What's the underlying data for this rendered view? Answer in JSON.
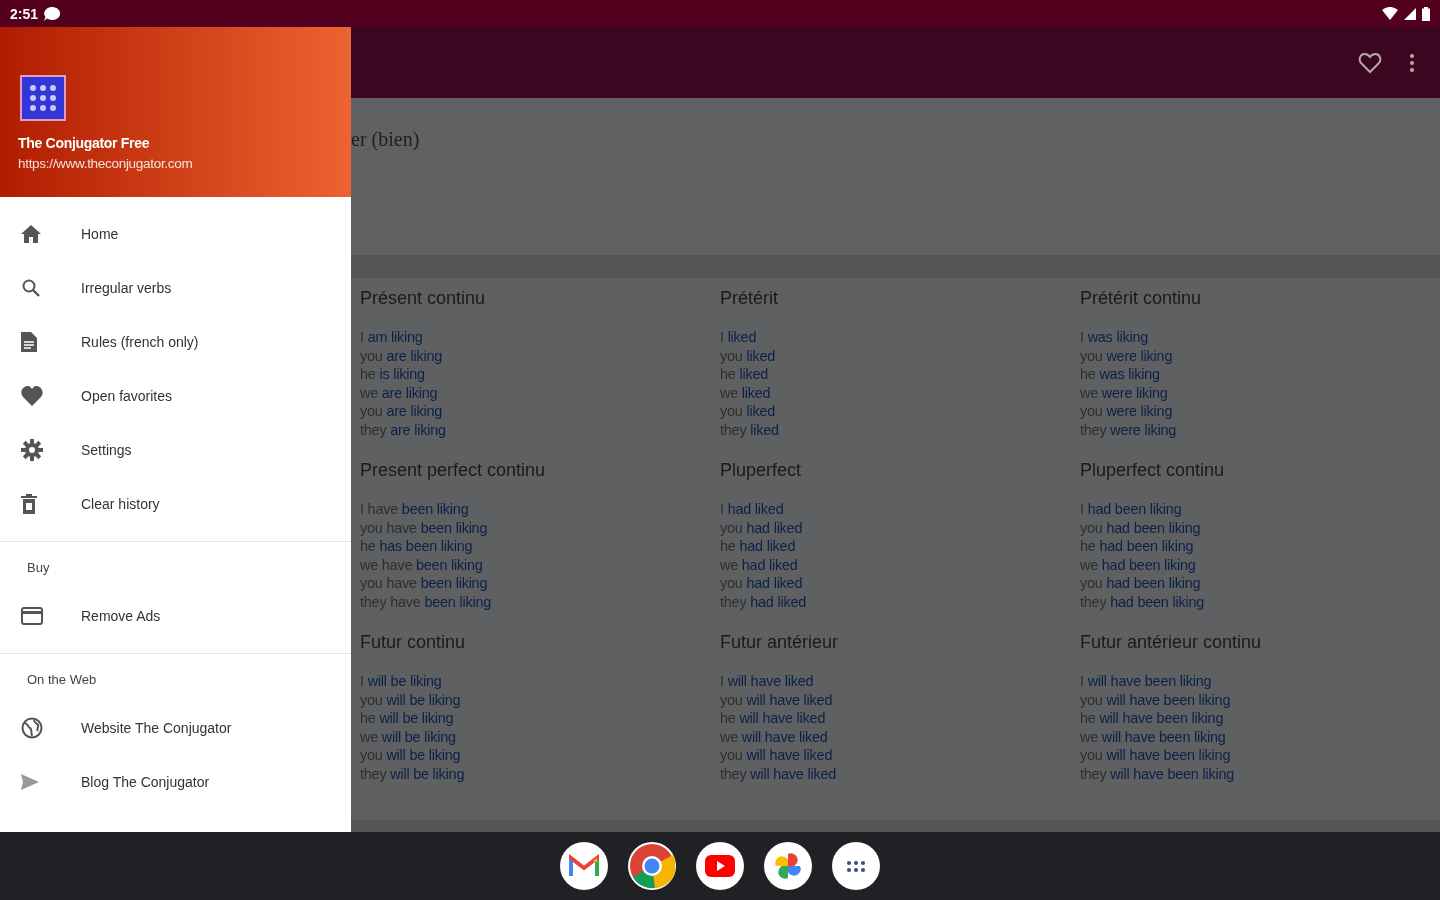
{
  "status_bar": {
    "time": "2:51"
  },
  "drawer": {
    "app_name": "The Conjugator Free",
    "url": "https://www.theconjugator.com",
    "sections": [
      {
        "items": [
          "Home",
          "Irregular verbs",
          "Rules (french only)",
          "Open favorites",
          "Settings",
          "Clear history"
        ]
      },
      {
        "header": "Buy",
        "items": [
          "Remove Ads"
        ]
      },
      {
        "header": "On the Web",
        "items": [
          "Website The Conjugator",
          "Blog The Conjugator"
        ]
      }
    ]
  },
  "verb_title": "er (bien)",
  "tenses": [
    {
      "name": "Présent continu",
      "lines": [
        {
          "pronoun": "I",
          "verb": "am liking"
        },
        {
          "pronoun": "you",
          "verb": "are liking"
        },
        {
          "pronoun": "he",
          "verb": "is liking"
        },
        {
          "pronoun": "we",
          "verb": "are liking"
        },
        {
          "pronoun": "you",
          "verb": "are liking"
        },
        {
          "pronoun": "they",
          "verb": "are liking"
        }
      ]
    },
    {
      "name": "Prétérit",
      "lines": [
        {
          "pronoun": "I",
          "verb": "liked"
        },
        {
          "pronoun": "you",
          "verb": "liked"
        },
        {
          "pronoun": "he",
          "verb": "liked"
        },
        {
          "pronoun": "we",
          "verb": "liked"
        },
        {
          "pronoun": "you",
          "verb": "liked"
        },
        {
          "pronoun": "they",
          "verb": "liked"
        }
      ]
    },
    {
      "name": "Prétérit continu",
      "lines": [
        {
          "pronoun": "I",
          "verb": "was liking"
        },
        {
          "pronoun": "you",
          "verb": "were liking"
        },
        {
          "pronoun": "he",
          "verb": "was liking"
        },
        {
          "pronoun": "we",
          "verb": "were liking"
        },
        {
          "pronoun": "you",
          "verb": "were liking"
        },
        {
          "pronoun": "they",
          "verb": "were liking"
        }
      ]
    },
    {
      "name": "Present perfect continu",
      "lines": [
        {
          "pronoun": "I have",
          "verb": "been liking"
        },
        {
          "pronoun": "you have",
          "verb": "been liking"
        },
        {
          "pronoun": "he",
          "verb": "has been liking"
        },
        {
          "pronoun": "we have",
          "verb": "been liking"
        },
        {
          "pronoun": "you have",
          "verb": "been liking"
        },
        {
          "pronoun": "they have",
          "verb": "been liking"
        }
      ]
    },
    {
      "name": "Pluperfect",
      "lines": [
        {
          "pronoun": "I",
          "verb": "had liked"
        },
        {
          "pronoun": "you",
          "verb": "had liked"
        },
        {
          "pronoun": "he",
          "verb": "had liked"
        },
        {
          "pronoun": "we",
          "verb": "had liked"
        },
        {
          "pronoun": "you",
          "verb": "had liked"
        },
        {
          "pronoun": "they",
          "verb": "had liked"
        }
      ]
    },
    {
      "name": "Pluperfect continu",
      "lines": [
        {
          "pronoun": "I",
          "verb": "had been liking"
        },
        {
          "pronoun": "you",
          "verb": "had been liking"
        },
        {
          "pronoun": "he",
          "verb": "had been liking"
        },
        {
          "pronoun": "we",
          "verb": "had been liking"
        },
        {
          "pronoun": "you",
          "verb": "had been liking"
        },
        {
          "pronoun": "they",
          "verb": "had been liking"
        }
      ]
    },
    {
      "name": "Futur continu",
      "lines": [
        {
          "pronoun": "I",
          "verb": "will be liking"
        },
        {
          "pronoun": "you",
          "verb": "will be liking"
        },
        {
          "pronoun": "he",
          "verb": "will be liking"
        },
        {
          "pronoun": "we",
          "verb": "will be liking"
        },
        {
          "pronoun": "you",
          "verb": "will be liking"
        },
        {
          "pronoun": "they",
          "verb": "will be liking"
        }
      ]
    },
    {
      "name": "Futur antérieur",
      "lines": [
        {
          "pronoun": "I",
          "verb": "will have liked"
        },
        {
          "pronoun": "you",
          "verb": "will have liked"
        },
        {
          "pronoun": "he",
          "verb": "will have liked"
        },
        {
          "pronoun": "we",
          "verb": "will have liked"
        },
        {
          "pronoun": "you",
          "verb": "will have liked"
        },
        {
          "pronoun": "they",
          "verb": "will have liked"
        }
      ]
    },
    {
      "name": "Futur antérieur continu",
      "lines": [
        {
          "pronoun": "I",
          "verb": "will have been liking"
        },
        {
          "pronoun": "you",
          "verb": "will have been liking"
        },
        {
          "pronoun": "he",
          "verb": "will have been liking"
        },
        {
          "pronoun": "we",
          "verb": "will have been liking"
        },
        {
          "pronoun": "you",
          "verb": "will have been liking"
        },
        {
          "pronoun": "they",
          "verb": "will have been liking"
        }
      ]
    }
  ]
}
